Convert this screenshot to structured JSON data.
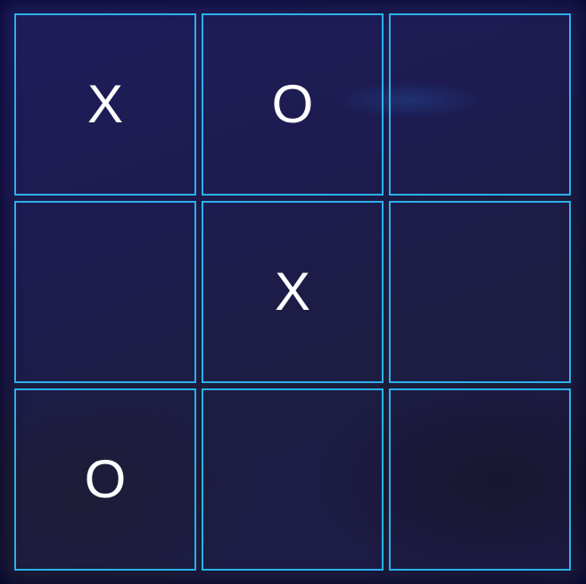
{
  "board": {
    "cells": [
      {
        "row": 1,
        "col": 1,
        "mark": "X"
      },
      {
        "row": 1,
        "col": 2,
        "mark": "O"
      },
      {
        "row": 1,
        "col": 3,
        "mark": ""
      },
      {
        "row": 2,
        "col": 1,
        "mark": ""
      },
      {
        "row": 2,
        "col": 2,
        "mark": "X"
      },
      {
        "row": 2,
        "col": 3,
        "mark": ""
      },
      {
        "row": 3,
        "col": 1,
        "mark": "O"
      },
      {
        "row": 3,
        "col": 2,
        "mark": ""
      },
      {
        "row": 3,
        "col": 3,
        "mark": ""
      }
    ]
  },
  "colors": {
    "cell_border": "#2ab2ea",
    "mark": "#ffffff",
    "background": "#1c1b4c"
  }
}
